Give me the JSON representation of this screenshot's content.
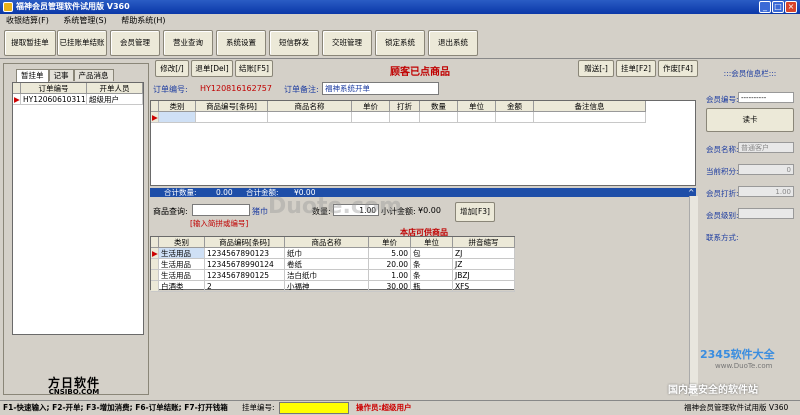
{
  "window": {
    "title": "福神会员管理软件试用版  V360"
  },
  "menu": [
    "收银结算(F)",
    "系统管理(S)",
    "帮助系统(H)"
  ],
  "toolbar": [
    "提取暂挂单",
    "已挂账单结账",
    "会员管理",
    "营业查询",
    "系统设置",
    "短信群发",
    "交班管理",
    "锁定系统",
    "退出系统"
  ],
  "left": {
    "tabs": [
      "暂挂单",
      "记事",
      "产品消息"
    ],
    "headers": [
      "订单编号",
      "开单人员"
    ],
    "rows": [
      [
        "HY120606103115",
        "超级用户"
      ]
    ],
    "logo": "方日软件",
    "logo_sub": "CNSIBO.COM"
  },
  "order": {
    "buttons": {
      "edit": "修改[/]",
      "return": "退单[Del]",
      "checkout": "结账[F5]",
      "gift": "赠送[-]",
      "hold": "挂单[F2]",
      "void": "作废[F4]"
    },
    "heading": "顾客已点商品",
    "number_label": "订单编号:",
    "number": "HY120816162757",
    "remark_label": "订单备注:",
    "remark": "福神系统开单",
    "headers": [
      "类别",
      "商品编号[条码]",
      "商品名称",
      "单价",
      "打折",
      "数量",
      "单位",
      "金额",
      "备注信息"
    ],
    "total_qty_label": "合计数量:",
    "total_qty": "0.00",
    "total_amount_label": "合计金额:",
    "total_amount": "¥0.00"
  },
  "search": {
    "label": "商品查询:",
    "unit": "猪巾",
    "hint": "[输入简拼或编号]",
    "qty_label": "数量:",
    "qty": "1.00",
    "subtotal_label": "小计金额:",
    "subtotal": "¥0.00",
    "add_button": "增加[F3]",
    "heading": "本店可供商品",
    "headers": [
      "类别",
      "商品编码[条码]",
      "商品名称",
      "单价",
      "单位",
      "拼音缩写"
    ],
    "rows": [
      [
        "生活用品",
        "1234567890123",
        "纸巾",
        "5.00",
        "包",
        "ZJ"
      ],
      [
        "生活用品",
        "12345678990124",
        "卷纸",
        "20.00",
        "条",
        "JZ"
      ],
      [
        "生活用品",
        "1234567890125",
        "洁白纸巾",
        "1.00",
        "条",
        "JBZJ"
      ],
      [
        "白酒类",
        "2",
        "小福神",
        "30.00",
        "瓶",
        "XFS"
      ]
    ]
  },
  "member": {
    "title": ":::会员信息栏:::",
    "id_label": "会员编号:",
    "id_value": "----------",
    "read_card": "读卡",
    "name_label": "会员名称:",
    "name_value": "普通客户",
    "points_label": "当前积分:",
    "points_value": "0",
    "discount_label": "会员打折:",
    "discount_value": "1.00",
    "level_label": "会员级别:",
    "contact_label": "联系方式:"
  },
  "status": {
    "shortcuts": "F1-快速输入; F2-开单; F3-增加消费; F6-订单结账; F7-打开钱箱",
    "order_label": "挂单编号:",
    "operator": "操作员:超级用户",
    "product": "福神会员管理软件试用版  V360"
  },
  "watermarks": [
    "Duote.com",
    "2345软件大全",
    "www.DuoTe.com",
    "国内最安全的软件站"
  ],
  "colors": {
    "accent": "#c00000",
    "title_bar": "#0a37a8",
    "order_field": "#ffff00"
  }
}
